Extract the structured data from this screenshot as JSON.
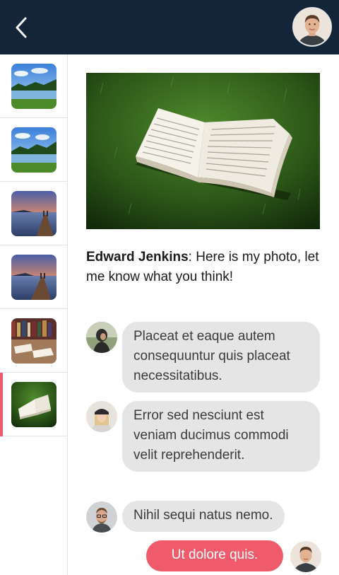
{
  "header": {
    "back_icon": "chevron-left-icon",
    "avatar_icon": "user-avatar",
    "colors": {
      "bar": "#14253a"
    }
  },
  "sidebar": {
    "items": [
      {
        "thumbnail": "lake-forest-photo",
        "active": false
      },
      {
        "thumbnail": "lake-forest-photo",
        "active": false
      },
      {
        "thumbnail": "sunset-pier-photo",
        "active": false
      },
      {
        "thumbnail": "sunset-pier-photo",
        "active": false
      },
      {
        "thumbnail": "books-on-table-photo",
        "active": false
      },
      {
        "thumbnail": "book-on-grass-photo",
        "active": true
      }
    ],
    "active_color": "#ef5b6a"
  },
  "post": {
    "photo": "open-book-on-grass-photo",
    "author": "Edward Jenkins",
    "text": ": Here is my photo, let me know what you think!"
  },
  "messages": [
    {
      "text": "Placeat et eaque autem consequuntur quis placeat necessitatibus.",
      "mine": false
    },
    {
      "text": "Error sed nesciunt est veniam ducimus commodi velit reprehenderit.",
      "mine": false
    },
    {
      "text": "Nihil sequi natus nemo.",
      "mine": false
    },
    {
      "text": "Ut dolore quis.",
      "mine": true
    }
  ],
  "colors": {
    "incoming_bubble": "#e5e5e5",
    "outgoing_bubble": "#ef5b6a"
  }
}
